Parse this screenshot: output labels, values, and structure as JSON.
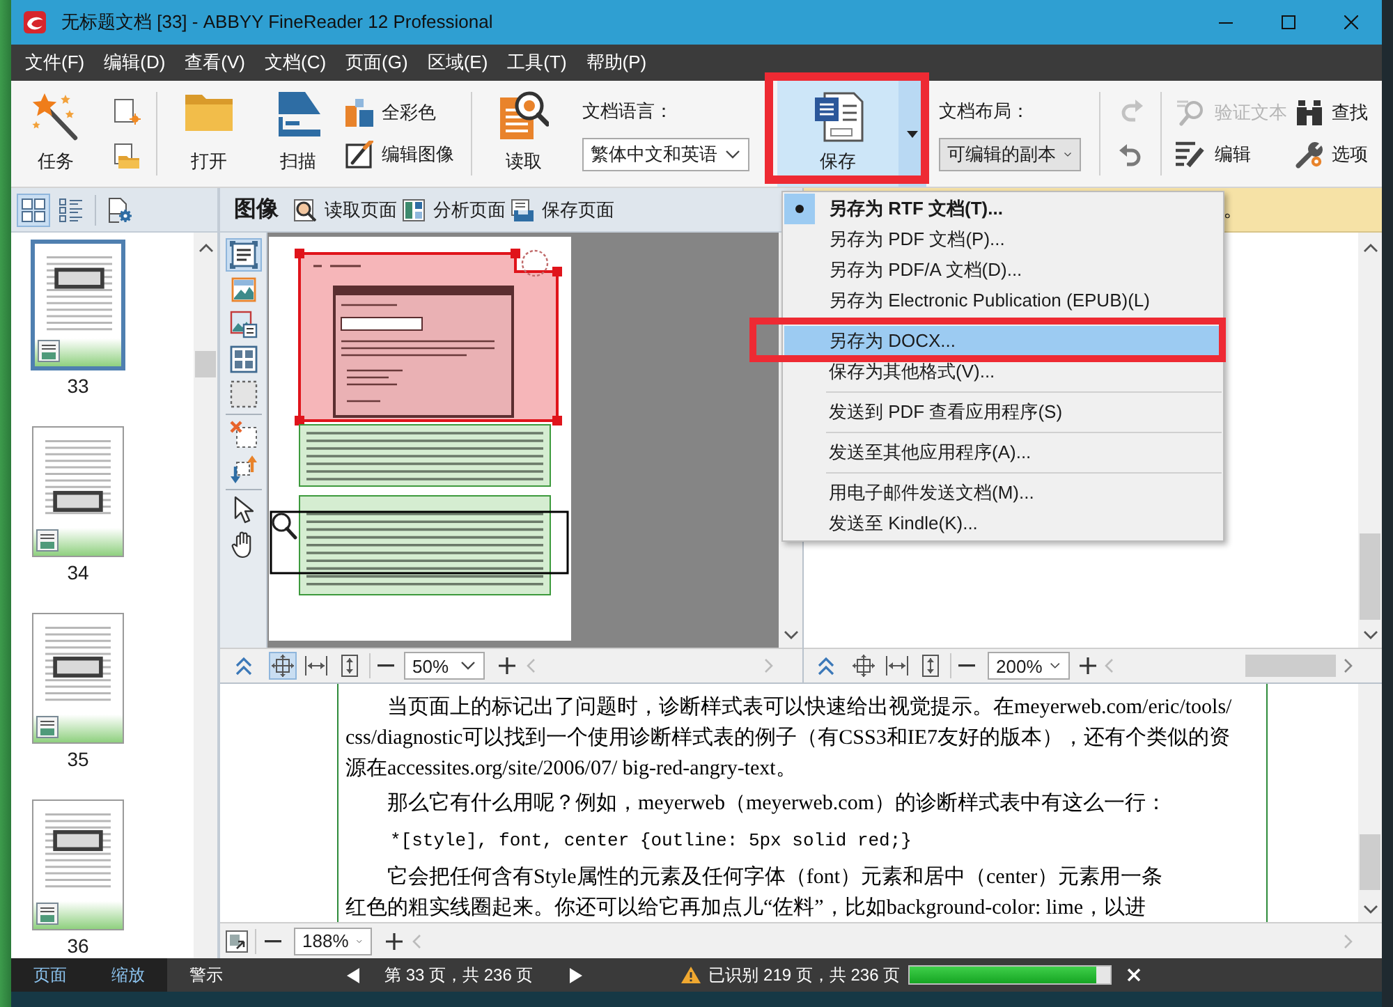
{
  "window": {
    "title": "无标题文档 [33] - ABBYY FineReader 12 Professional"
  },
  "menu_bar": [
    "文件(F)",
    "编辑(D)",
    "查看(V)",
    "文档(C)",
    "页面(G)",
    "区域(E)",
    "工具(T)",
    "帮助(P)"
  ],
  "toolbar": {
    "task": {
      "label": "任务"
    },
    "open": {
      "label": "打开"
    },
    "scan": {
      "label": "扫描"
    },
    "image_actions": [
      {
        "kind": "color",
        "label": "全彩色"
      },
      {
        "kind": "edit-image",
        "label": "编辑图像"
      }
    ],
    "read": {
      "label": "读取"
    },
    "language": {
      "label": "文档语言：",
      "value": "繁体中文和英语"
    },
    "save": {
      "label": "保存",
      "pressed": true
    },
    "layout": {
      "label": "文档布局：",
      "value": "可编辑的副本"
    },
    "history": [
      {
        "kind": "redo",
        "disabled": true
      },
      {
        "kind": "undo",
        "disabled": false
      }
    ],
    "text_actions": [
      {
        "kind": "verify",
        "label": "验证文本",
        "disabled": true
      },
      {
        "kind": "edit",
        "label": "编辑",
        "disabled": false
      }
    ],
    "tools": [
      {
        "kind": "find",
        "label": "查找"
      },
      {
        "kind": "options",
        "label": "选项"
      }
    ]
  },
  "save_menu": {
    "items": [
      {
        "kind": "item",
        "label": "另存为 RTF 文档(T)...",
        "checked": true,
        "selected": false
      },
      {
        "kind": "item",
        "label": "另存为 PDF 文档(P)...",
        "checked": false,
        "selected": false
      },
      {
        "kind": "item",
        "label": "另存为 PDF/A 文档(D)...",
        "checked": false,
        "selected": false
      },
      {
        "kind": "item",
        "label": "另存为 Electronic Publication (EPUB)(L)",
        "checked": false,
        "selected": false
      },
      {
        "kind": "separator"
      },
      {
        "kind": "item",
        "label": "另存为 DOCX...",
        "checked": false,
        "selected": true
      },
      {
        "kind": "item",
        "label": "保存为其他格式(V)...",
        "checked": false,
        "selected": false
      },
      {
        "kind": "separator"
      },
      {
        "kind": "item",
        "label": "发送到 PDF 查看应用程序(S)",
        "checked": false,
        "selected": false
      },
      {
        "kind": "separator"
      },
      {
        "kind": "item",
        "label": "发送至其他应用程序(A)...",
        "checked": false,
        "selected": false
      },
      {
        "kind": "separator"
      },
      {
        "kind": "item",
        "label": "用电子邮件发送文档(M)...",
        "checked": false,
        "selected": false
      },
      {
        "kind": "item",
        "label": "发送至 Kindle(K)...",
        "checked": false,
        "selected": false
      }
    ]
  },
  "thumbnails": {
    "views": [
      {
        "kind": "grid",
        "selected": true
      },
      {
        "kind": "list",
        "selected": false
      }
    ],
    "pages": [
      {
        "number": "33",
        "selected": true
      },
      {
        "number": "34",
        "selected": false
      },
      {
        "number": "35",
        "selected": false
      },
      {
        "number": "36",
        "selected": false
      }
    ]
  },
  "image_pane": {
    "title": "图像",
    "actions": [
      {
        "kind": "read",
        "label": "读取页面"
      },
      {
        "kind": "analyze",
        "label": "分析页面"
      },
      {
        "kind": "save",
        "label": "保存页面"
      }
    ],
    "tools": [
      [
        {
          "kind": "text",
          "selected": true
        },
        {
          "kind": "picture",
          "selected": false
        },
        {
          "kind": "background",
          "selected": false
        },
        {
          "kind": "table",
          "selected": false
        },
        {
          "kind": "region",
          "selected": false
        }
      ],
      [
        {
          "kind": "delete",
          "selected": false
        },
        {
          "kind": "order",
          "selected": false
        }
      ],
      [
        {
          "kind": "pointer",
          "selected": false
        },
        {
          "kind": "hand",
          "selected": false
        }
      ]
    ],
    "fit_modes": [
      {
        "kind": "page",
        "selected": true
      },
      {
        "kind": "width",
        "selected": false
      },
      {
        "kind": "height",
        "selected": false
      }
    ],
    "zoom": "50%"
  },
  "text_pane": {
    "notice": "。",
    "fit_modes": [
      {
        "kind": "page",
        "selected": false
      },
      {
        "kind": "width",
        "selected": false
      },
      {
        "kind": "height",
        "selected": false
      }
    ],
    "zoom": "200%"
  },
  "zoom_pane": {
    "paragraphs": [
      {
        "kind": "text",
        "lines": [
          "当页面上的标记出了问题时，诊断样式表可以快速给出视觉提示。在meyerweb.com/eric/tools/",
          "css/diagnostic可以找到一个使用诊断样式表的例子（有CSS3和IE7友好的版本），还有个类似的资",
          "源在accessites.org/site/2006/07/ big-red-angry-text。"
        ]
      },
      {
        "kind": "text",
        "lines": [
          "那么它有什么用呢？例如，meyerweb（meyerweb.com）的诊断样式表中有这么一行："
        ]
      },
      {
        "kind": "code",
        "lines": [
          "*[style], font, center {outline: 5px solid red;}"
        ]
      },
      {
        "kind": "text",
        "lines": [
          "它会把任何含有Style属性的元素及任何字体（font）元素和居中（center）元素用一条",
          "红色的粗实线圈起来。你还可以给它再加点儿“佐料”，比如background-color: lime，以进"
        ]
      }
    ],
    "zoom": "188%"
  },
  "status_bar": {
    "tabs": [
      {
        "label": "页面",
        "on": true
      },
      {
        "label": "缩放",
        "on": true
      },
      {
        "label": "警示",
        "on": false
      }
    ],
    "page_info": "第 33 页，共 236 页",
    "recognized": "已识别 219 页，共 236 页",
    "progress": {
      "level": 0.93
    }
  }
}
